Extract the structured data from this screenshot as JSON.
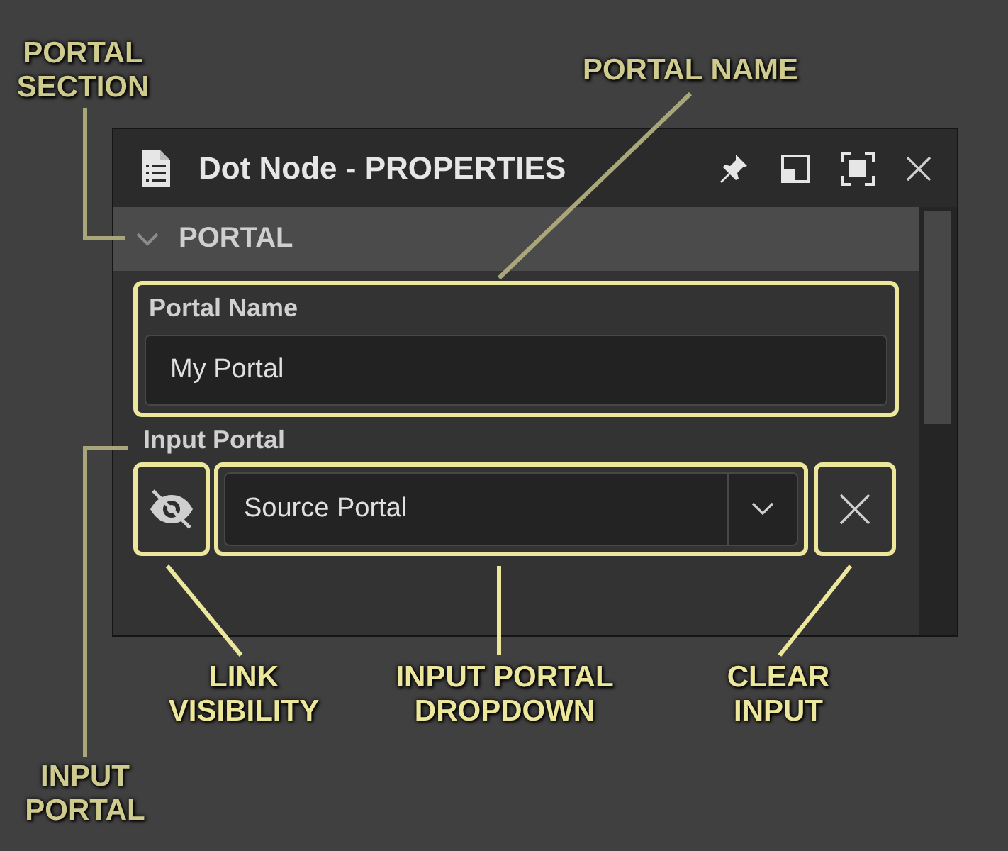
{
  "window": {
    "title": "Dot Node - PROPERTIES"
  },
  "section": {
    "label": "PORTAL",
    "expanded": true
  },
  "portal_name": {
    "label": "Portal Name",
    "value": "My Portal"
  },
  "input_portal": {
    "label": "Input Portal",
    "link_visible": false,
    "value": "Source Portal"
  },
  "annotations": [
    {
      "text": "PORTAL\nSECTION"
    },
    {
      "text": "PORTAL NAME"
    },
    {
      "text": "LINK\nVISIBILITY"
    },
    {
      "text": "INPUT PORTAL\nDROPDOWN"
    },
    {
      "text": "CLEAR\nINPUT"
    },
    {
      "text": "INPUT\nPORTAL"
    }
  ]
}
